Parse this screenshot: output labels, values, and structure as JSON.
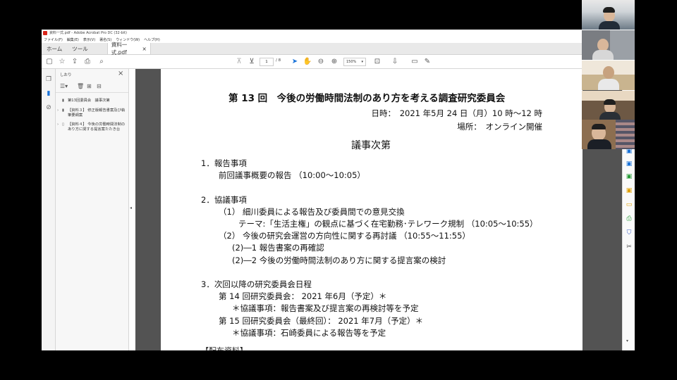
{
  "window": {
    "title": "資料一式.pdf - Adobe Acrobat Pro DC (32-bit)"
  },
  "menu": {
    "items": [
      "ファイル(F)",
      "編集(E)",
      "表示(V)",
      "署名(S)",
      "ウィンドウ(W)",
      "ヘルプ(H)"
    ]
  },
  "tabs": {
    "home": "ホーム",
    "tools": "ツール",
    "document": "資料一式.pdf",
    "close": "×"
  },
  "toolbar": {
    "page_current": "1",
    "page_total": "/ 8",
    "zoom": "150%"
  },
  "sidebar": {
    "title": "しおり",
    "close": "×",
    "items": [
      {
        "label": "第13回委員会　議事次第",
        "expandable": false
      },
      {
        "label": "【資料３】 修正版報告書案及び執筆要綱案",
        "expandable": true
      },
      {
        "label": "【資料４】 今後の労働時間法制のあり方に関する提言案たたき台",
        "expandable": true
      }
    ]
  },
  "document": {
    "title": "第 13 回　今後の労働時間法制のあり方を考える調査研究委員会",
    "date": "日時：　2021 年5月 24 日（月）10 時～12 時",
    "place": "場所：　オンライン開催",
    "agenda_heading": "議事次第",
    "lines": [
      {
        "text": "1．報告事項",
        "indent": 0
      },
      {
        "text": "前回議事概要の報告 （10:00～10:05）",
        "indent": 1
      },
      {
        "text": "",
        "indent": 0
      },
      {
        "text": "2．協議事項",
        "indent": 0
      },
      {
        "text": "（1） 細川委員による報告及び委員間での意見交換",
        "indent": 1
      },
      {
        "text": "テーマ:「生活主権」の観点に基づく在宅勤務･テレワーク規制 （10:05～10:55）",
        "indent": 3
      },
      {
        "text": "（2） 今後の研究会運営の方向性に関する再討議 （10:55～11:55）",
        "indent": 1
      },
      {
        "text": "(2)―1 報告書案の再確認",
        "indent": 2
      },
      {
        "text": "(2)―2 今後の労働時間法制のあり方に関する提言案の検討",
        "indent": 2
      },
      {
        "text": "",
        "indent": 0
      },
      {
        "text": "3．次回以降の研究委員会日程",
        "indent": 0
      },
      {
        "text": "第 14 回研究委員会： 2021 年6月（予定）＊",
        "indent": 1
      },
      {
        "text": "＊協議事項：報告書案及び提言案の再検討等を予定",
        "indent": 2
      },
      {
        "text": "第 15 回研究委員会（最終回）： 2021 年7月（予定）＊",
        "indent": 1
      },
      {
        "text": "＊協議事項：石崎委員による報告等を予定",
        "indent": 2
      }
    ],
    "partial_footer": "【配布資料】"
  },
  "icons": {
    "star": "☆",
    "upload": "⇪",
    "print": "⎙",
    "search": "⌕",
    "up": "⊕",
    "down": "⊖",
    "hand": "✋",
    "zoom_out": "⊖",
    "zoom_in": "⊕",
    "pointer": "➤",
    "comment": "▭",
    "pen": "✎"
  },
  "colors": {
    "accent_blue": "#1a73d9",
    "acrobat_red": "#d9261c",
    "doc_background": "#535353"
  }
}
